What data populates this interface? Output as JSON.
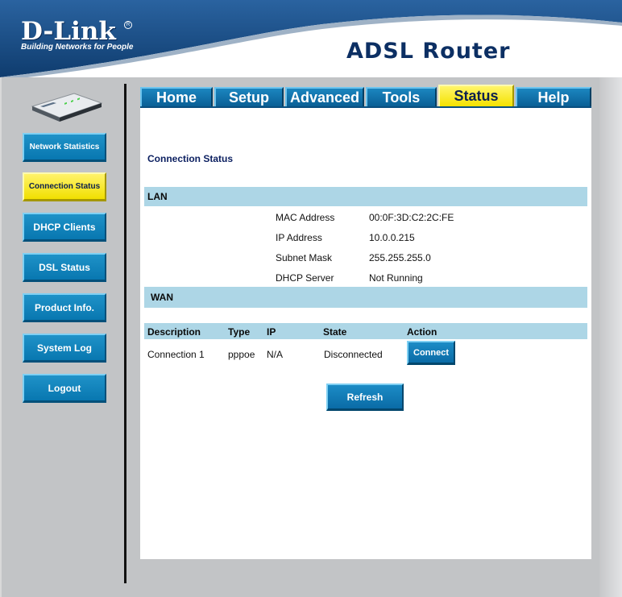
{
  "header": {
    "brand": "D-Link",
    "tagline": "Building Networks for People",
    "product_title": "ADSL Router"
  },
  "tabs": [
    {
      "label": "Home"
    },
    {
      "label": "Setup"
    },
    {
      "label": "Advanced"
    },
    {
      "label": "Tools"
    },
    {
      "label": "Status",
      "active": true
    },
    {
      "label": "Help"
    }
  ],
  "sidebar": {
    "items": [
      {
        "label": "Network Statistics"
      },
      {
        "label": "Connection Status",
        "active": true
      },
      {
        "label": "DHCP Clients"
      },
      {
        "label": "DSL Status"
      },
      {
        "label": "Product Info."
      },
      {
        "label": "System Log"
      },
      {
        "label": "Logout"
      }
    ]
  },
  "main": {
    "title": "Connection Status",
    "lan": {
      "header": "LAN",
      "rows": [
        {
          "label": "MAC Address",
          "value": "00:0F:3D:C2:2C:FE"
        },
        {
          "label": "IP Address",
          "value": "10.0.0.215"
        },
        {
          "label": "Subnet Mask",
          "value": "255.255.255.0"
        },
        {
          "label": "DHCP Server",
          "value": "Not Running"
        }
      ]
    },
    "wan": {
      "header": "WAN",
      "columns": [
        "Description",
        "Type",
        "IP",
        "State",
        "Action"
      ],
      "rows": [
        {
          "description": "Connection 1",
          "type": "pppoe",
          "ip": "N/A",
          "state": "Disconnected",
          "action": "Connect"
        }
      ]
    },
    "refresh_label": "Refresh"
  },
  "colors": {
    "header_blue": "#1b4f86",
    "nav_blue": "#0877b0",
    "active_yellow": "#f4e200",
    "section_bar": "#add6e6",
    "title_navy": "#0b1f60"
  }
}
